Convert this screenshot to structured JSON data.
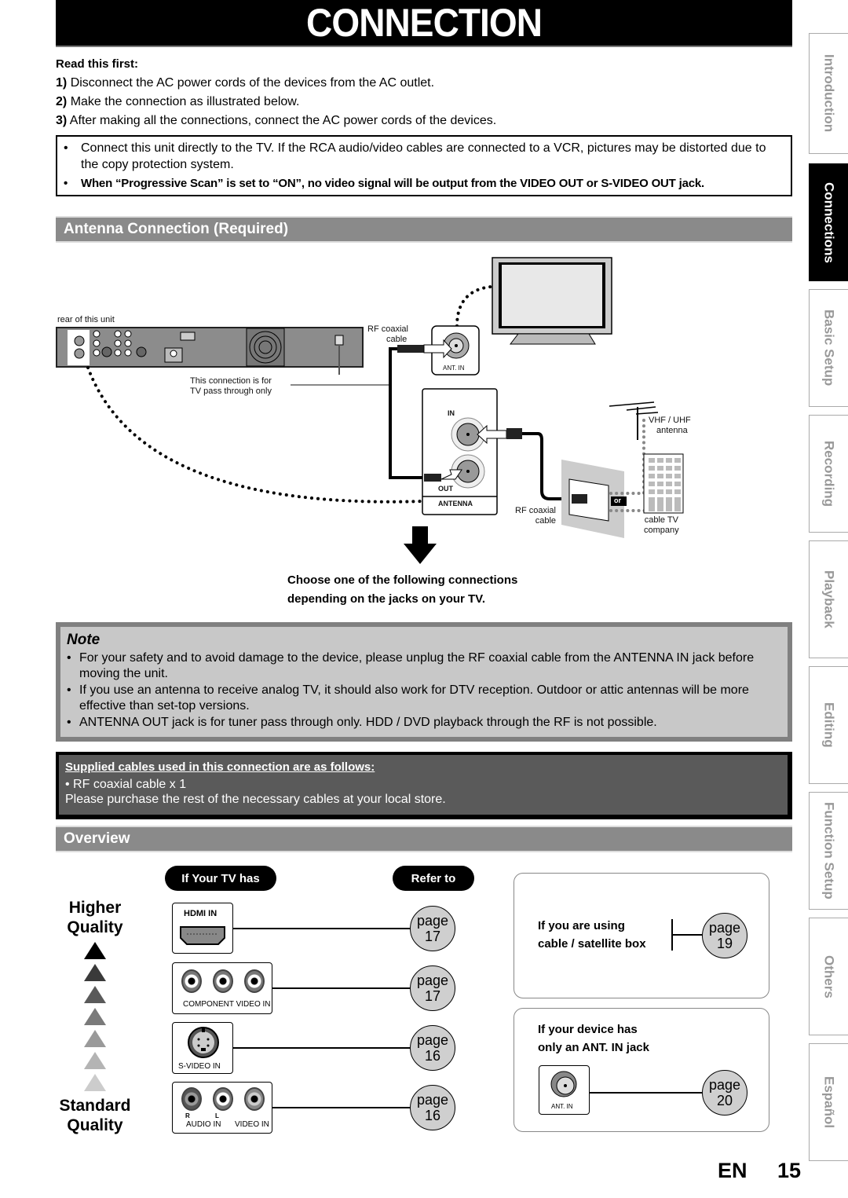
{
  "page": {
    "title": "CONNECTION",
    "language_code": "EN",
    "page_number": "15"
  },
  "side_tabs": [
    {
      "label": "Introduction",
      "active": false
    },
    {
      "label": "Connections",
      "active": true
    },
    {
      "label": "Basic Setup",
      "active": false
    },
    {
      "label": "Recording",
      "active": false
    },
    {
      "label": "Playback",
      "active": false
    },
    {
      "label": "Editing",
      "active": false
    },
    {
      "label": "Function Setup",
      "active": false
    },
    {
      "label": "Others",
      "active": false
    },
    {
      "label": "Español",
      "active": false
    }
  ],
  "read_first": {
    "heading": "Read this first:",
    "steps": [
      {
        "num": "1)",
        "text": "Disconnect the AC power cords of the devices from the AC outlet."
      },
      {
        "num": "2)",
        "text": "Make the connection as illustrated below."
      },
      {
        "num": "3)",
        "text": "After making all the connections, connect the AC power cords of the devices."
      }
    ]
  },
  "warnings": [
    {
      "bullet": "•",
      "text": "Connect this unit directly to the TV. If the RCA audio/video cables are connected to a VCR, pictures may be distorted due to the copy protection system."
    },
    {
      "bullet": "•",
      "text": "When “Progressive Scan” is set to “ON”, no video signal will be output from the VIDEO OUT or S-VIDEO OUT jack."
    }
  ],
  "antenna_section": {
    "heading": "Antenna Connection (Required)",
    "diagram_labels": {
      "rear_unit": "rear of this unit",
      "rf_cable_top_1": "RF coaxial",
      "rf_cable_top_2": "cable",
      "ant_in": "ANT. IN",
      "pass_through_1": "This connection is for",
      "pass_through_2": "TV pass through only",
      "in": "IN",
      "out": "OUT",
      "antenna": "ANTENNA",
      "vhf_uhf_1": "VHF / UHF",
      "vhf_uhf_2": "antenna",
      "or": "or",
      "rf_cable_bottom_1": "RF coaxial",
      "rf_cable_bottom_2": "cable",
      "cable_tv_1": "cable TV",
      "cable_tv_2": "company"
    },
    "choose_line_1": "Choose one of the following connections",
    "choose_line_2": "depending on the jacks on your TV."
  },
  "note": {
    "title": "Note",
    "items": [
      "For your safety and to avoid damage to the device, please unplug the RF coaxial cable from the ANTENNA IN jack before moving the unit.",
      "If you use an antenna to receive analog TV, it should also work for DTV reception. Outdoor or attic antennas will be more effective than set-top versions.",
      "ANTENNA OUT jack is for tuner pass through only. HDD / DVD playback through the RF is not possible."
    ]
  },
  "supplied": {
    "heading": "Supplied cables used in this connection are as follows:",
    "item": "• RF coaxial cable x 1",
    "note": "Please purchase the rest of the necessary cables at your local store."
  },
  "overview": {
    "heading": "Overview",
    "col_tv_has": "If Your TV has",
    "col_refer_to": "Refer to",
    "higher_quality_1": "Higher",
    "higher_quality_2": "Quality",
    "standard_quality_1": "Standard",
    "standard_quality_2": "Quality",
    "rows": [
      {
        "jack": "HDMI IN",
        "page_word": "page",
        "page": "17"
      },
      {
        "jack": "COMPONENT VIDEO IN",
        "page_word": "page",
        "page": "17"
      },
      {
        "jack": "S-VIDEO IN",
        "page_word": "page",
        "page": "16"
      },
      {
        "jack": "AUDIO IN   VIDEO IN",
        "audio_r": "R",
        "audio_l": "L",
        "audio_label": "AUDIO IN",
        "video_label": "VIDEO IN",
        "page_word": "page",
        "page": "16"
      }
    ],
    "alternatives": [
      {
        "line1": "If you are using",
        "line2": "cable / satellite box",
        "page_word": "page",
        "page": "19"
      },
      {
        "line1": "If your device has",
        "line2": "only an ANT. IN jack",
        "jack": "ANT. IN",
        "page_word": "page",
        "page": "20"
      }
    ],
    "quality_colors": [
      "#000000",
      "#3a3a3a",
      "#5a5a5a",
      "#7a7a7a",
      "#9a9a9a",
      "#b4b4b4",
      "#cccccc"
    ]
  }
}
